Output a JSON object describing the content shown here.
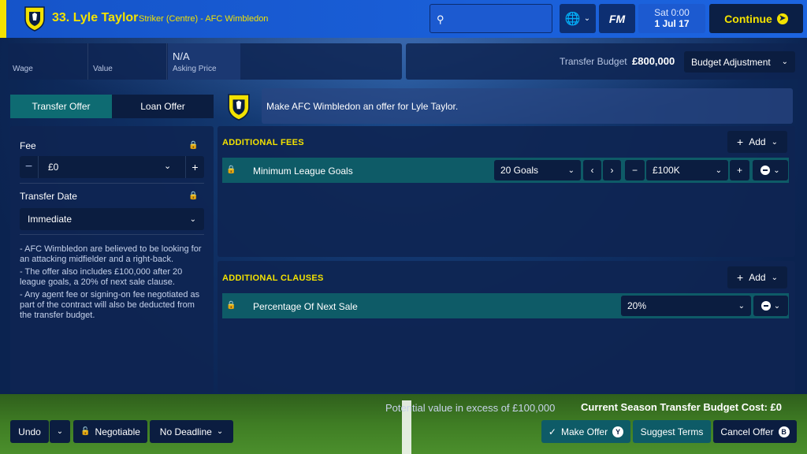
{
  "header": {
    "player_name": "33. Lyle Taylor",
    "player_subtitle": "Striker (Centre) - AFC Wimbledon",
    "date_day": "Sat 0:00",
    "date_date": "1 Jul 17",
    "continue_label": "Continue",
    "fm_label": "FM"
  },
  "info": {
    "wage_label": "Wage",
    "value_label": "Value",
    "asking_value": "N/A",
    "asking_label": "Asking Price",
    "budget_label": "Transfer Budget",
    "budget_value": "£800,000",
    "budget_adjust_label": "Budget Adjustment"
  },
  "tabs": {
    "transfer": "Transfer Offer",
    "loan": "Loan Offer"
  },
  "message": "Make AFC Wimbledon an offer for Lyle Taylor.",
  "left": {
    "fee_label": "Fee",
    "fee_value": "£0",
    "date_label": "Transfer Date",
    "date_value": "Immediate",
    "notes": [
      "- AFC Wimbledon are believed to be looking for an attacking midfielder and a right-back.",
      "-  The offer also includes £100,000 after 20 league goals, a 20% of next sale clause.",
      "- Any agent fee or signing-on fee negotiated as part of the contract will also be deducted from the transfer budget."
    ]
  },
  "fees": {
    "title": "ADDITIONAL FEES",
    "add_label": "Add",
    "row_label": "Minimum League Goals",
    "goals_value": "20 Goals",
    "amount_value": "£100K"
  },
  "clauses": {
    "title": "ADDITIONAL CLAUSES",
    "add_label": "Add",
    "row_label": "Percentage Of Next Sale",
    "pct_value": "20%"
  },
  "bottom": {
    "potential": "Potential value in excess of £100,000",
    "cost": "Current Season Transfer Budget Cost: £0",
    "undo": "Undo",
    "negotiable": "Negotiable",
    "deadline": "No Deadline",
    "make_offer": "Make Offer",
    "make_offer_key": "Y",
    "suggest_terms": "Suggest Terms",
    "cancel_offer": "Cancel Offer",
    "cancel_key": "B"
  },
  "colors": {
    "accent_yellow": "#f3e200",
    "topbar_blue": "#1a5fd8",
    "panel_navy": "#0e2552",
    "teal": "#0e5b67"
  }
}
